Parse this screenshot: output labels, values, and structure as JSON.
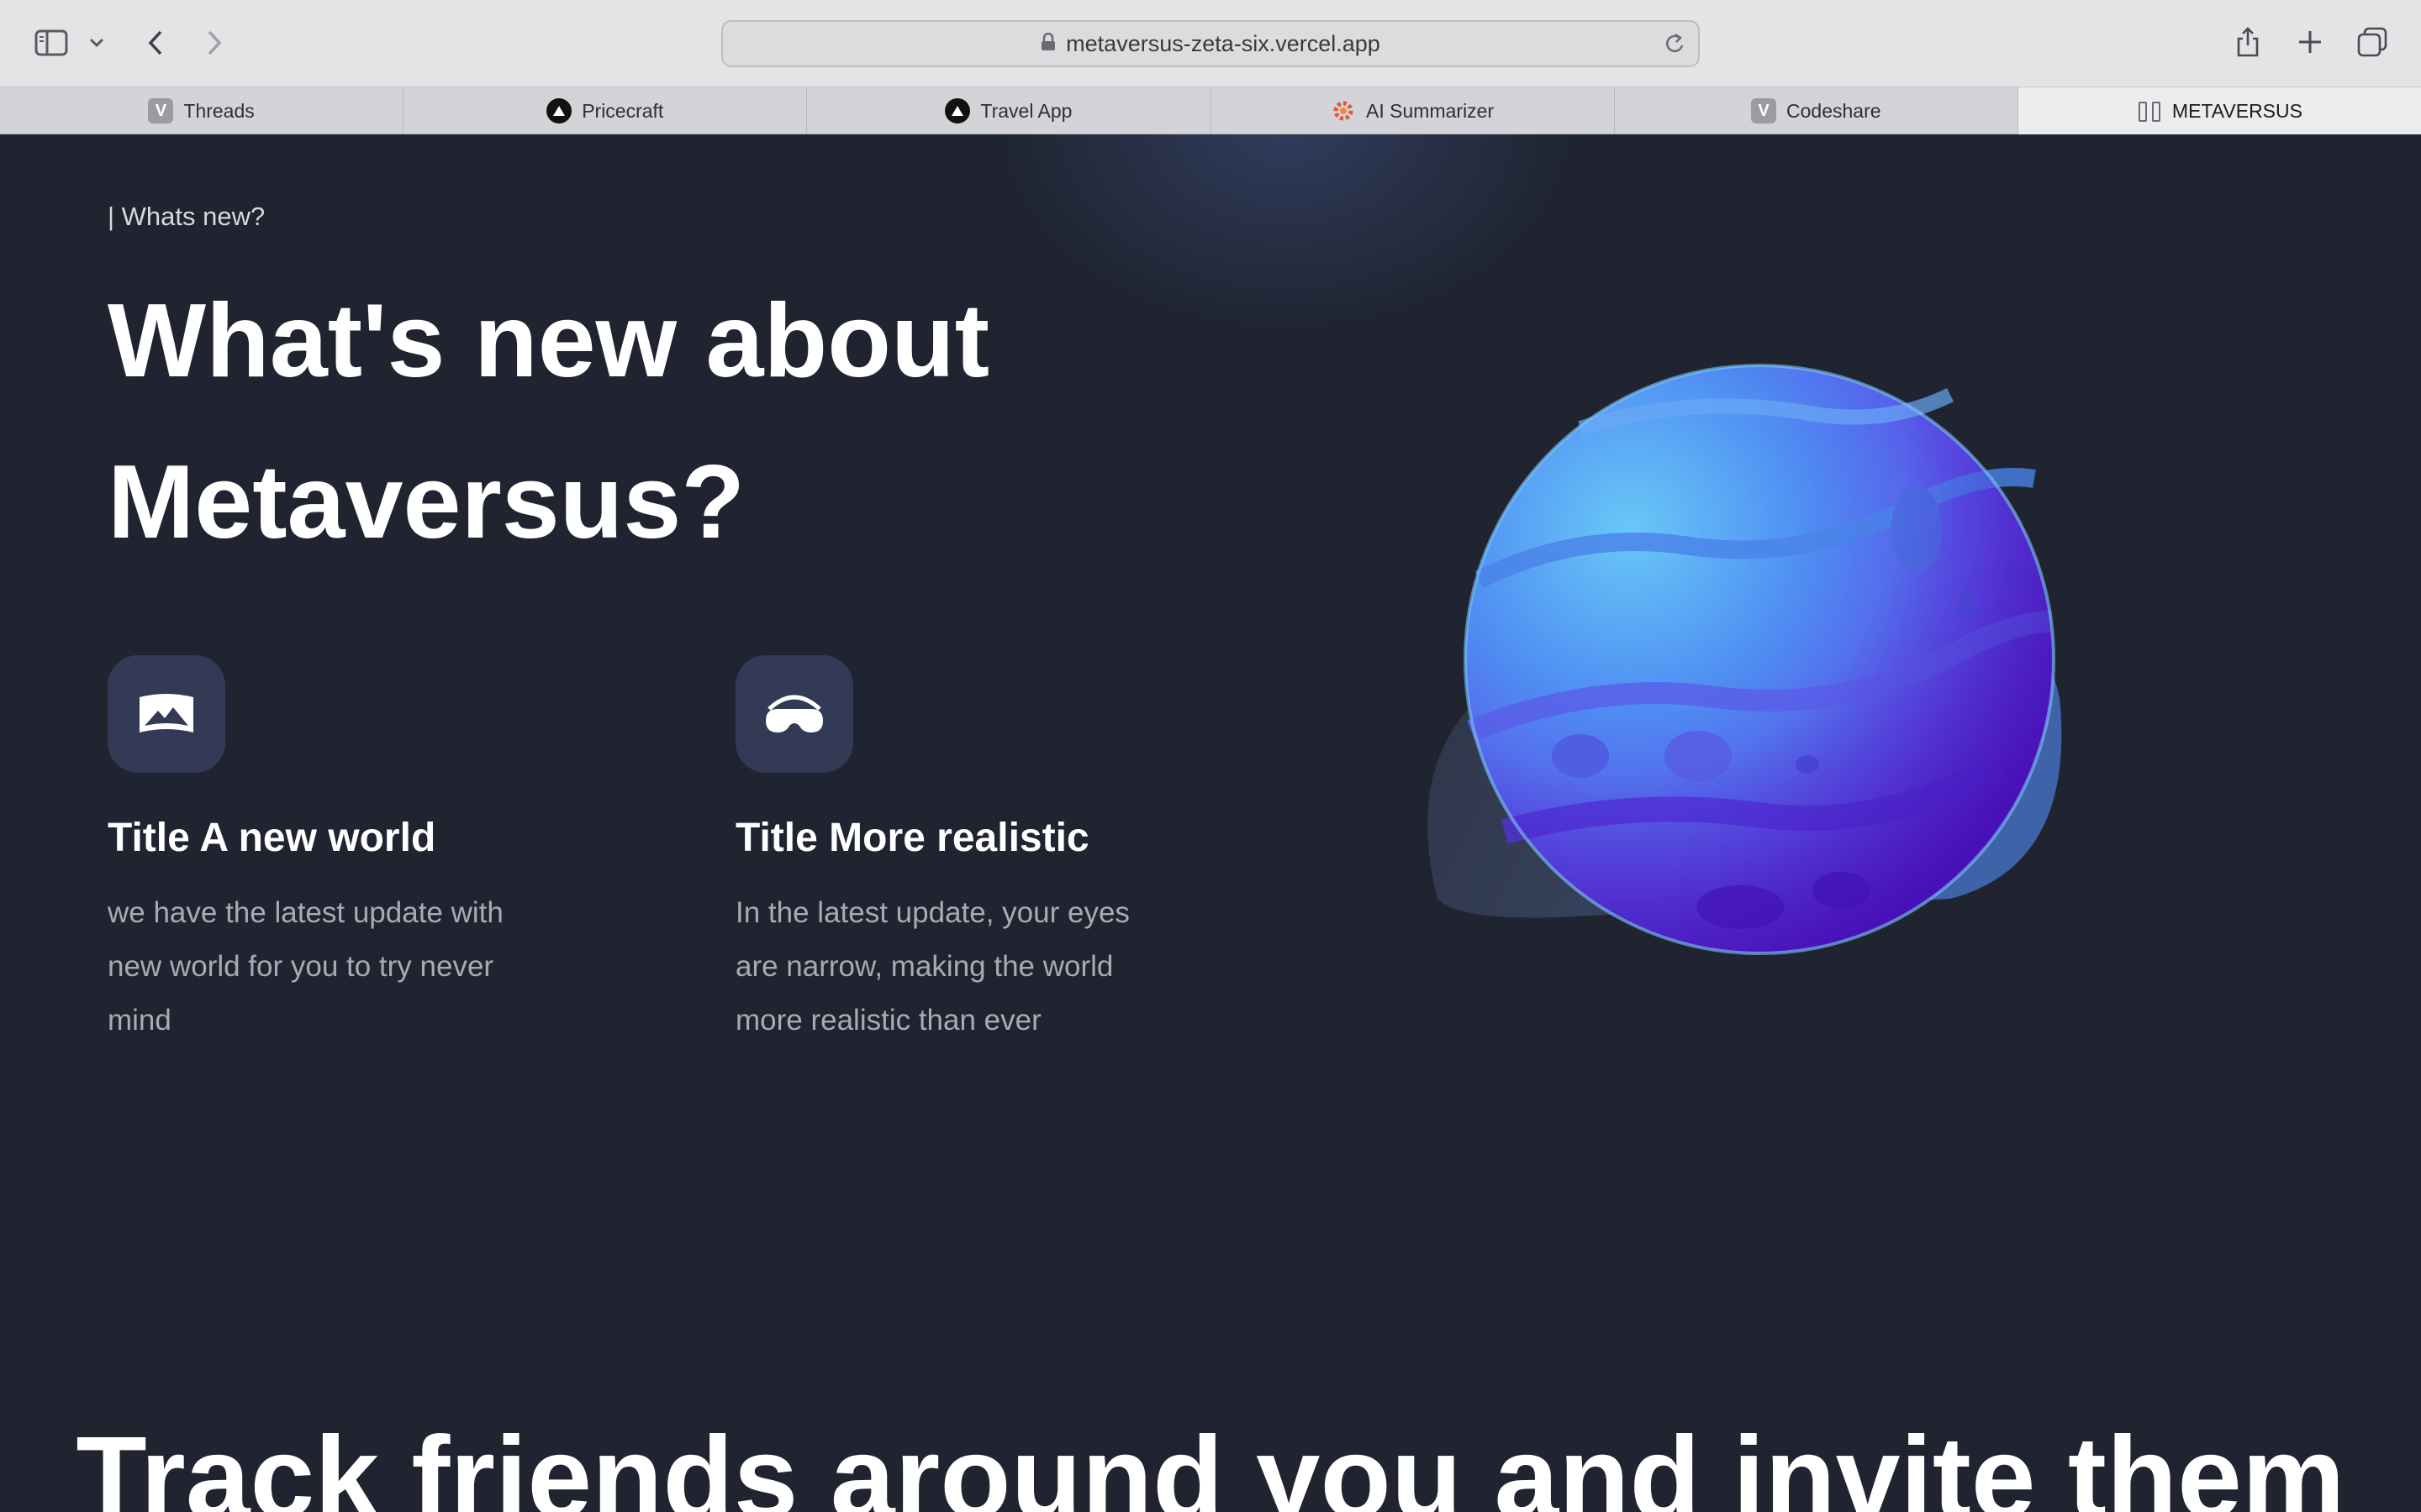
{
  "browser": {
    "url": "metaversus-zeta-six.vercel.app",
    "tabs": [
      {
        "label": "Threads",
        "favicon": "V"
      },
      {
        "label": "Pricecraft",
        "favicon": "triangle-icon"
      },
      {
        "label": "Travel App",
        "favicon": "triangle-icon"
      },
      {
        "label": "AI Summarizer",
        "favicon": "gear-icon"
      },
      {
        "label": "Codeshare",
        "favicon": "V"
      },
      {
        "label": "METAVERSUS",
        "favicon": "metaversus-icon"
      }
    ]
  },
  "page": {
    "eyebrow": "| Whats new?",
    "headline_line1": "What's new about",
    "headline_line2": "Metaversus?",
    "features": [
      {
        "icon": "landscape-icon",
        "title": "Title A new world",
        "description": "we have the latest update with new world for you to try never mind"
      },
      {
        "icon": "vr-headset-icon",
        "title": "Title More realistic",
        "description": "In the latest update, your eyes are narrow, making the world more realistic than ever"
      }
    ],
    "bottom_headline": "Track friends around you and invite them"
  },
  "colors": {
    "background": "#1f2430",
    "icon_tile": "#323a55",
    "planet_light": "#5fb8f5",
    "planet_dark": "#5a1ed6"
  }
}
